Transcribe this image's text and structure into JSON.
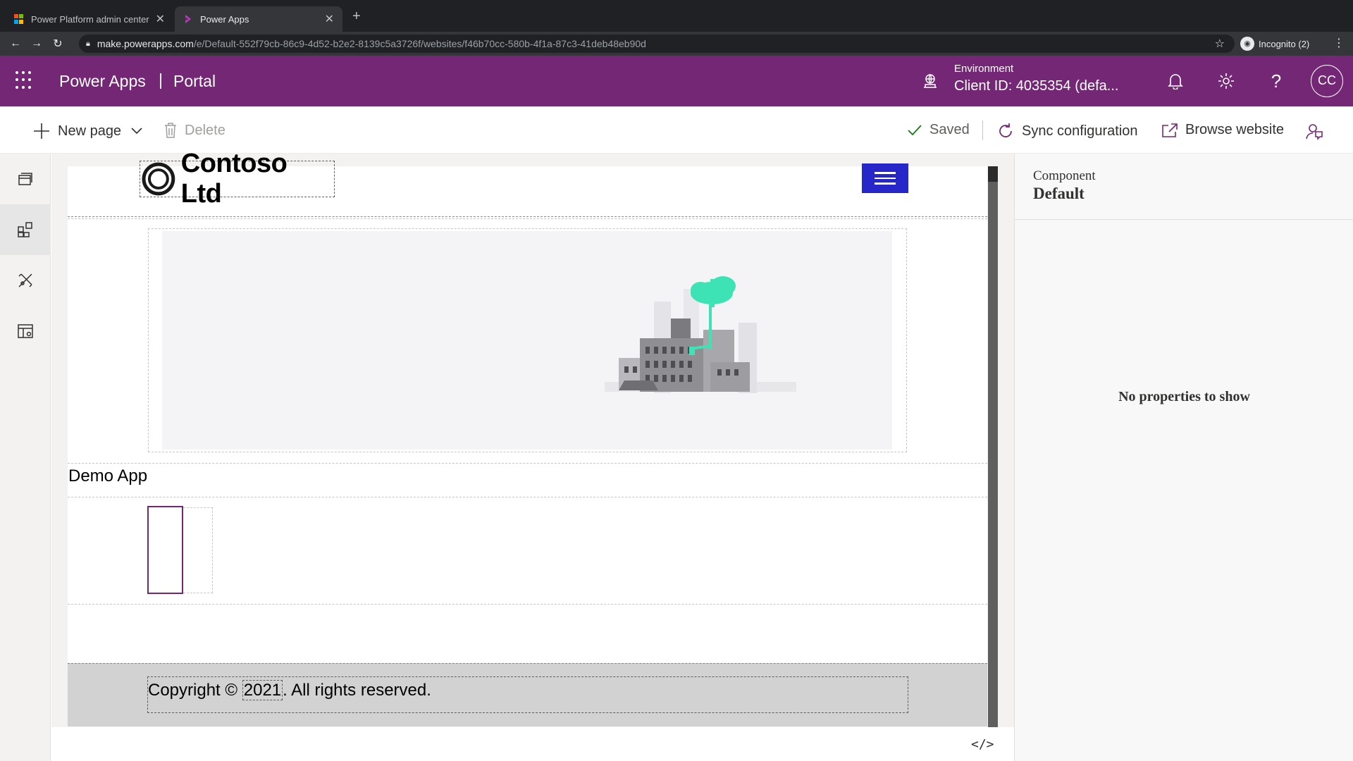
{
  "browser": {
    "tabs": [
      {
        "title": "Power Platform admin center",
        "active": false
      },
      {
        "title": "Power Apps",
        "active": true
      }
    ],
    "url_host": "make.powerapps.com",
    "url_path": "/e/Default-552f79cb-86c9-4d52-b2e2-8139c5a3726f/websites/f46b70cc-580b-4f1a-87c3-41deb48eb90d",
    "profile_label": "Incognito (2)"
  },
  "header": {
    "app_name": "Power Apps",
    "separator": "|",
    "section": "Portal",
    "environment_label": "Environment",
    "environment_value": "Client ID: 4035354 (defa...",
    "avatar_initials": "CC",
    "brand_color": "#742774"
  },
  "commands": {
    "new_page": "New page",
    "delete": "Delete",
    "saved": "Saved",
    "sync": "Sync configuration",
    "browse": "Browse website"
  },
  "rail": {
    "items": [
      "pages-icon",
      "components-icon",
      "themes-icon",
      "templates-icon"
    ],
    "selected": "components-icon"
  },
  "site": {
    "logo_text": "Contoso Ltd",
    "nav_color": "#2626c9",
    "section_title": "Demo App",
    "footer_prefix": "Copyright ©",
    "footer_year": "2021",
    "footer_suffix": ". All rights reserved."
  },
  "properties": {
    "label": "Component",
    "value": "Default",
    "empty_message": "No properties to show"
  },
  "code_toggle": "</>"
}
